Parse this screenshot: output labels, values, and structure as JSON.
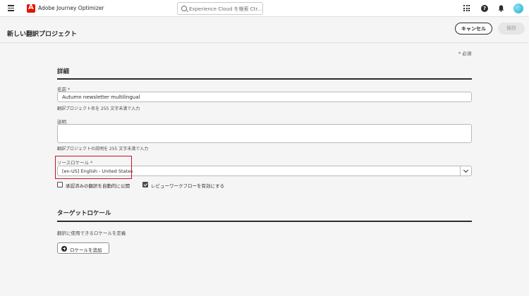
{
  "app": {
    "title": "Adobe Journey Optimizer"
  },
  "search": {
    "placeholder": "Experience Cloud を検索 Ctr..."
  },
  "icons": {
    "menu": "hamburger-icon",
    "logo": "adobe-logo-icon",
    "search": "search-icon",
    "apps": "apps-grid-icon",
    "help": "help-icon",
    "notifications": "bell-icon",
    "dropdown": "chevron-down-icon",
    "add": "add-icon"
  },
  "header": {
    "title": "新しい翻訳プロジェクト",
    "cancel_label": "キャンセル",
    "save_label": "保存"
  },
  "form": {
    "required_note": "* 必須",
    "details": {
      "title": "詳細",
      "name_label": "名前",
      "name_required": "*",
      "name_value": "Autumn newsletter multilingual",
      "name_help": "翻訳プロジェクト名を 255 文字未満で入力",
      "description_label": "説明",
      "description_value": "",
      "description_help": "翻訳プロジェクトの説明を 255 文字未満で入力",
      "source_locale_label": "ソースロケール",
      "source_locale_required": "*",
      "source_locale_value": "[en-US] English - United States",
      "auto_publish_label": "承認済みの翻訳を自動的に公開",
      "auto_publish_checked": false,
      "review_workflow_label": "レビューワークフローを有効にする",
      "review_workflow_checked": true
    },
    "target_locales": {
      "title": "ターゲットロケール",
      "description": "翻訳に使用できるロケールを定義",
      "add_label": "ロケールを追加"
    }
  },
  "colors": {
    "highlight": "#c8102e",
    "adobe_red": "#eb1000",
    "text": "#2c2c2c"
  }
}
